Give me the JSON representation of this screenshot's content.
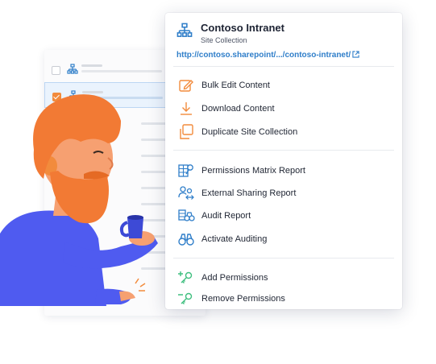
{
  "site": {
    "title": "Contoso Intranet",
    "subtitle": "Site Collection",
    "url": "http://contoso.sharepoint/.../contoso-intranet/",
    "icon": "sitemap-icon"
  },
  "colors": {
    "accent_orange": "#f28b3c",
    "accent_blue": "#2f7ec9",
    "accent_green": "#3fbf7f",
    "selected_row": "#eaf3fd"
  },
  "menu": {
    "groups": [
      {
        "items": [
          {
            "label": "Bulk Edit Content",
            "icon": "edit-icon"
          },
          {
            "label": "Download Content",
            "icon": "download-icon"
          },
          {
            "label": "Duplicate Site Collection",
            "icon": "duplicate-icon"
          }
        ]
      },
      {
        "items": [
          {
            "label": "Permissions Matrix Report",
            "icon": "permissions-matrix-icon"
          },
          {
            "label": "External Sharing Report",
            "icon": "external-sharing-icon"
          },
          {
            "label": "Audit Report",
            "icon": "audit-report-icon"
          },
          {
            "label": "Activate Auditing",
            "icon": "binoculars-icon"
          }
        ]
      },
      {
        "items": [
          {
            "label": "Add Permissions",
            "icon": "add-key-icon"
          },
          {
            "label": "Remove Permissions",
            "icon": "remove-key-icon"
          }
        ]
      }
    ]
  },
  "background_list": {
    "rows": [
      {
        "checked": false,
        "selected": false,
        "icon": "sitemap-icon"
      },
      {
        "checked": true,
        "selected": true,
        "icon": "sitemap-icon"
      }
    ]
  }
}
